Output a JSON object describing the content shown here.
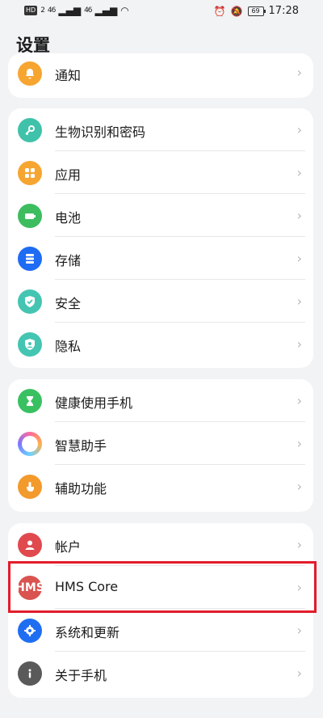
{
  "status_bar": {
    "left_badge": "HD",
    "left_sub": "2",
    "signal1": "46",
    "signal2": "46",
    "battery": "69",
    "time": "17:28"
  },
  "page_title": "设置",
  "groups": [
    {
      "items": [
        {
          "label": "通知",
          "icon": "bell-icon"
        }
      ]
    },
    {
      "items": [
        {
          "label": "生物识别和密码",
          "icon": "key-icon"
        },
        {
          "label": "应用",
          "icon": "apps-grid-icon"
        },
        {
          "label": "电池",
          "icon": "battery-icon"
        },
        {
          "label": "存储",
          "icon": "storage-icon"
        },
        {
          "label": "安全",
          "icon": "shield-check-icon"
        },
        {
          "label": "隐私",
          "icon": "privacy-user-icon"
        }
      ]
    },
    {
      "items": [
        {
          "label": "健康使用手机",
          "icon": "hourglass-icon"
        },
        {
          "label": "智慧助手",
          "icon": "assistant-ring-icon"
        },
        {
          "label": "辅助功能",
          "icon": "hand-icon"
        }
      ]
    },
    {
      "items": [
        {
          "label": "帐户",
          "icon": "account-icon"
        },
        {
          "label": "HMS Core",
          "icon": "hms-core-icon",
          "icon_text": "HMS"
        },
        {
          "label": "系统和更新",
          "icon": "settings-gear-icon"
        },
        {
          "label": "关于手机",
          "icon": "info-icon"
        }
      ]
    }
  ],
  "chevron": "›",
  "highlight_color": "#e21c2b"
}
